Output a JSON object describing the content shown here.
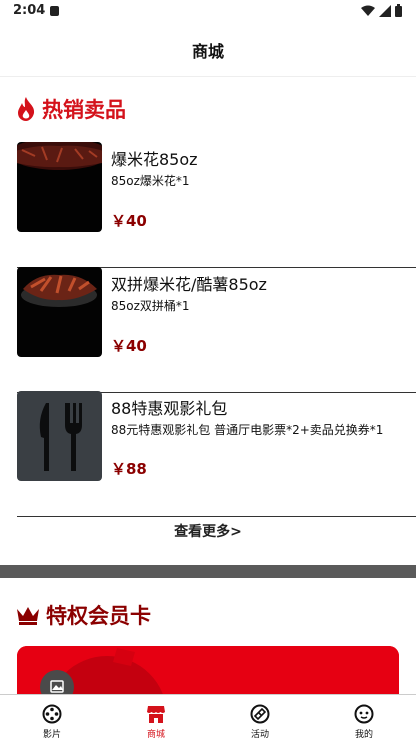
{
  "status_bar": {
    "time": "2:04"
  },
  "header": {
    "title": "商城"
  },
  "hot_section": {
    "title": "热销卖品"
  },
  "products": [
    {
      "name": "爆米花85oz",
      "desc": "85oz爆米花*1",
      "price": "￥40"
    },
    {
      "name": "双拼爆米花/酷薯85oz",
      "desc": "85oz双拼桶*1",
      "price": "￥40"
    },
    {
      "name": "88特惠观影礼包",
      "desc": "88元特惠观影礼包 普通厅电影票*2+卖品兑换券*1",
      "price": "￥88"
    }
  ],
  "see_more": "查看更多>",
  "vip_section": {
    "title": "特权会员卡"
  },
  "tabs": [
    {
      "label": "影片",
      "icon": "film-reel-icon",
      "active": false
    },
    {
      "label": "商城",
      "icon": "shop-icon",
      "active": true
    },
    {
      "label": "活动",
      "icon": "ticket-icon",
      "active": false
    },
    {
      "label": "我的",
      "icon": "face-icon",
      "active": false
    }
  ],
  "colors": {
    "accent": "#d4121b",
    "price": "#8b0000",
    "card": "#e60012"
  }
}
